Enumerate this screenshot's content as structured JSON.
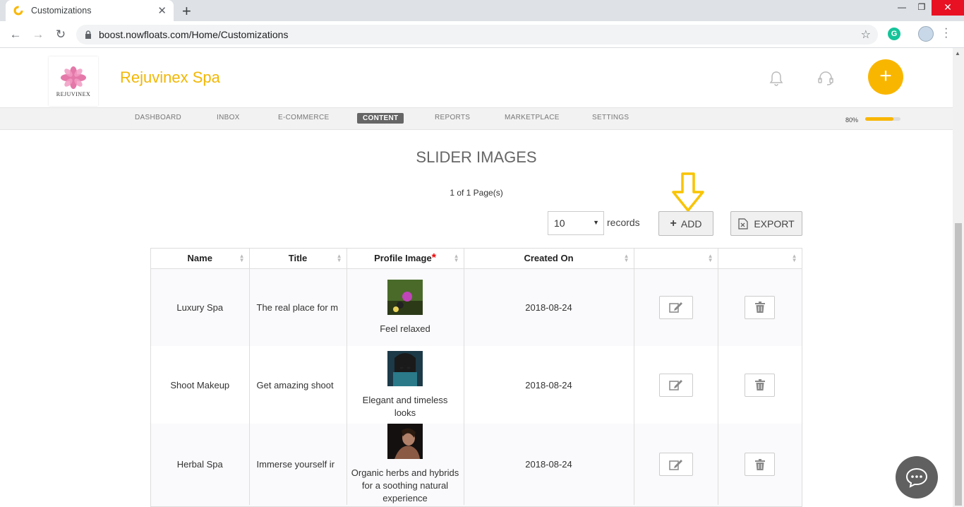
{
  "browser": {
    "tab_title": "Customizations",
    "url": "boost.nowfloats.com/Home/Customizations"
  },
  "app": {
    "logo_text": "REJUVINEX",
    "brand_name": "Rejuvinex Spa",
    "menu": [
      "DASHBOARD",
      "INBOX",
      "E-COMMERCE",
      "CONTENT",
      "REPORTS",
      "MARKETPLACE",
      "SETTINGS"
    ],
    "active_menu": "CONTENT",
    "progress_label": "80%",
    "progress_value": 0.8
  },
  "content": {
    "title": "SLIDER IMAGES",
    "pager_text": "1 of 1 Page(s)",
    "records_value": "10",
    "records_label": "records",
    "add_label": "ADD",
    "export_label": "EXPORT"
  },
  "table": {
    "headers": [
      "Name",
      "Title",
      "Profile Image",
      "Created On",
      "",
      ""
    ],
    "required_mark": "*",
    "rows": [
      {
        "name": "Luxury Spa",
        "title": "The real place for m",
        "caption": "Feel relaxed",
        "created": "2018-08-24"
      },
      {
        "name": "Shoot Makeup",
        "title": "Get amazing shoot",
        "caption": "Elegant and timeless looks",
        "created": "2018-08-24"
      },
      {
        "name": "Herbal Spa",
        "title": "Immerse yourself ir",
        "caption": "Organic herbs and hybrids for a soothing natural experience",
        "created": "2018-08-24"
      }
    ]
  },
  "colors": {
    "accent": "#f9b600",
    "brand": "#f2b705"
  }
}
